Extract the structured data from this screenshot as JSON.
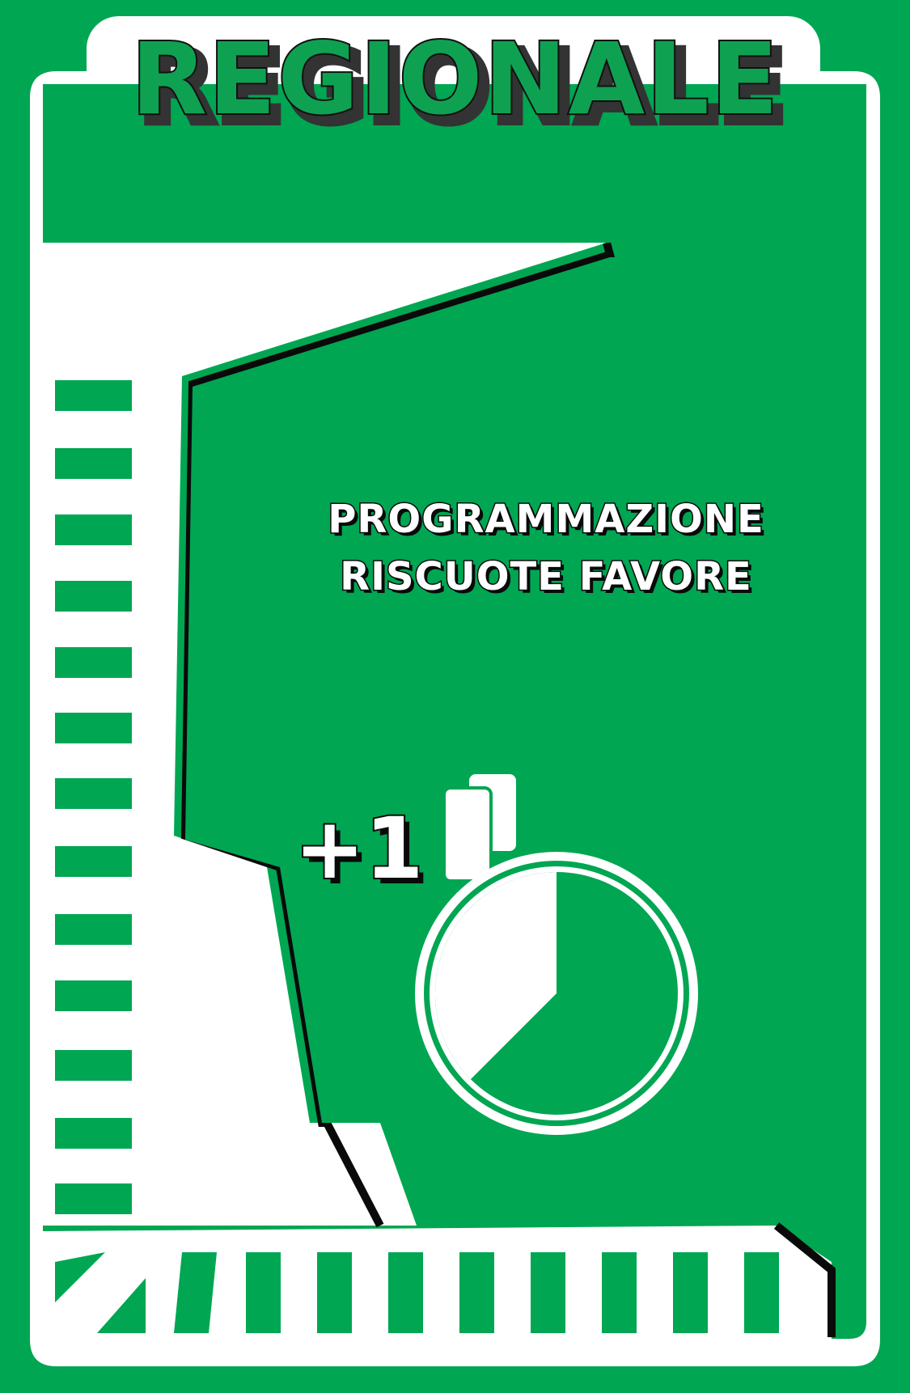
{
  "card": {
    "title": "REGIONALE",
    "text_line_1": "PROGRAMMAZIONE",
    "text_line_2": "RISCUOTE FAVORE",
    "bonus": "+1",
    "icons": {
      "time": "stopwatch-icon",
      "piece": "token-icon"
    },
    "timer_fraction": 0.375,
    "colors": {
      "green": "#00a652",
      "white": "#ffffff",
      "outline": "#0a0a0a",
      "title_fill": "#0fa152",
      "title_shadow": "#333333"
    }
  }
}
